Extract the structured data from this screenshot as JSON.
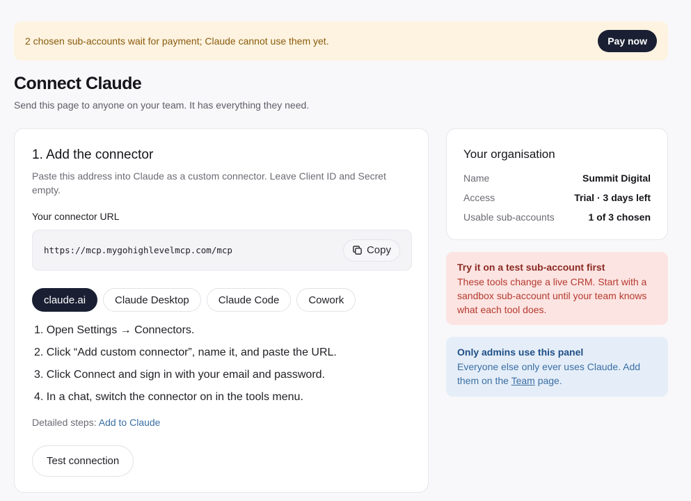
{
  "banner": {
    "message": "2 chosen sub-accounts wait for payment; Claude cannot use them yet.",
    "pay_label": "Pay now"
  },
  "page": {
    "title": "Connect Claude",
    "subtitle": "Send this page to anyone on your team. It has everything they need."
  },
  "connector": {
    "heading": "1. Add the connector",
    "description": "Paste this address into Claude as a custom connector. Leave Client ID and Secret empty.",
    "url_label": "Your connector URL",
    "url": "https://mcp.mygohighlevelmcp.com/mcp",
    "copy_label": "Copy",
    "tabs": [
      "claude.ai",
      "Claude Desktop",
      "Claude Code",
      "Cowork"
    ],
    "active_tab": "claude.ai",
    "steps": [
      "1. Open Settings → Connectors.",
      "2. Click “Add custom connector”, name it, and paste the URL.",
      "3. Click Connect and sign in with your email and password.",
      "4. In a chat, switch the connector on in the tools menu."
    ],
    "detailed_prefix": "Detailed steps:",
    "detailed_link": "Add to Claude",
    "test_label": "Test connection"
  },
  "organisation": {
    "heading": "Your organisation",
    "rows": [
      {
        "key": "Name",
        "value": "Summit Digital"
      },
      {
        "key": "Access",
        "value": "Trial · 3 days left"
      },
      {
        "key": "Usable sub-accounts",
        "value": "1 of 3 chosen"
      }
    ]
  },
  "warning": {
    "title": "Try it on a test sub-account first",
    "body": "These tools change a live CRM. Start with a sandbox sub-account until your team knows what each tool does."
  },
  "admin_notice": {
    "title": "Only admins use this panel",
    "body_before": "Everyone else only ever uses Claude. Add them on the",
    "link": "Team",
    "body_after": "page."
  },
  "colors": {
    "accent_dark": "#1a1f33",
    "banner_bg": "#fdf3e0",
    "warning_bg": "#fce4e2",
    "info_bg": "#e5eef8",
    "link": "#3a6ea5"
  }
}
